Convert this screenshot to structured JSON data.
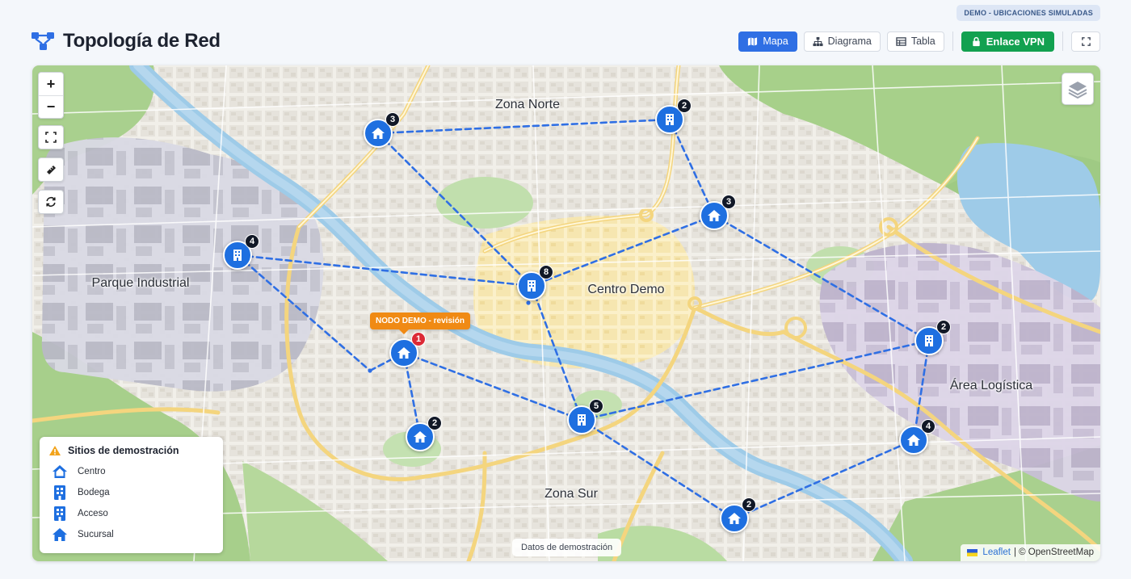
{
  "badge": "DEMO - UBICACIONES SIMULADAS",
  "header": {
    "title": "Topología de Red",
    "buttons": {
      "mapa": "Mapa",
      "diagrama": "Diagrama",
      "tabla": "Tabla",
      "vpn": "Enlace VPN"
    }
  },
  "map": {
    "areas": {
      "zona_norte": "Zona Norte",
      "parque_industrial": "Parque Industrial",
      "centro_demo": "Centro Demo",
      "area_logistica": "Área Logística",
      "zona_sur": "Zona Sur"
    },
    "controls": {
      "zoom_in": "+",
      "zoom_out": "−"
    },
    "tooltip": "NODO DEMO - revisión",
    "nodes": [
      {
        "id": "n1",
        "type": "sucursal",
        "count": "3"
      },
      {
        "id": "n2",
        "type": "bodega",
        "count": "2"
      },
      {
        "id": "n3",
        "type": "sucursal",
        "count": "3"
      },
      {
        "id": "n4",
        "type": "bodega",
        "count": "4"
      },
      {
        "id": "n5",
        "type": "bodega",
        "count": "8"
      },
      {
        "id": "n6",
        "type": "sucursal",
        "count": "1",
        "alert": true
      },
      {
        "id": "n7",
        "type": "sucursal",
        "count": "2"
      },
      {
        "id": "n8",
        "type": "bodega",
        "count": "5"
      },
      {
        "id": "n9",
        "type": "bodega",
        "count": "2"
      },
      {
        "id": "n10",
        "type": "sucursal",
        "count": "4"
      },
      {
        "id": "n11",
        "type": "sucursal",
        "count": "2"
      }
    ],
    "legend": {
      "title": "Sitios de demostración",
      "items": [
        "Centro",
        "Bodega",
        "Acceso",
        "Sucursal"
      ]
    },
    "demo_pill": "Datos de demostración",
    "attribution": {
      "leaflet": "Leaflet",
      "osm": "| © OpenStreetMap"
    }
  },
  "colors": {
    "accent": "#2f6fe4",
    "vpn": "#12a150",
    "marker": "#1e6fe0",
    "alert": "#dc2a36",
    "tooltip": "#f08a14",
    "link": "#2f6fe4"
  }
}
